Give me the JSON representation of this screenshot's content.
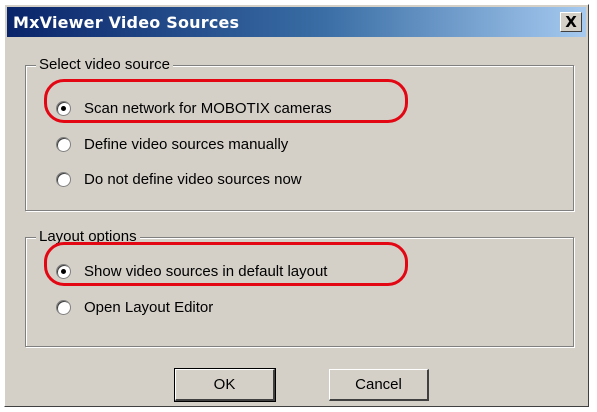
{
  "window": {
    "title": "MxViewer Video Sources",
    "close_label": "X"
  },
  "video_group": {
    "legend": "Select video source",
    "options": [
      {
        "label": "Scan network for MOBOTIX cameras",
        "checked": true
      },
      {
        "label": "Define video sources manually",
        "checked": false
      },
      {
        "label": "Do not define video sources now",
        "checked": false
      }
    ]
  },
  "layout_group": {
    "legend": "Layout options",
    "options": [
      {
        "label": "Show video sources in default layout",
        "checked": true
      },
      {
        "label": "Open Layout Editor",
        "checked": false
      }
    ]
  },
  "buttons": {
    "ok": "OK",
    "cancel": "Cancel"
  },
  "colors": {
    "highlight": "#e30613",
    "title_bar_start": "#0a246a",
    "title_bar_end": "#a6caf0"
  }
}
